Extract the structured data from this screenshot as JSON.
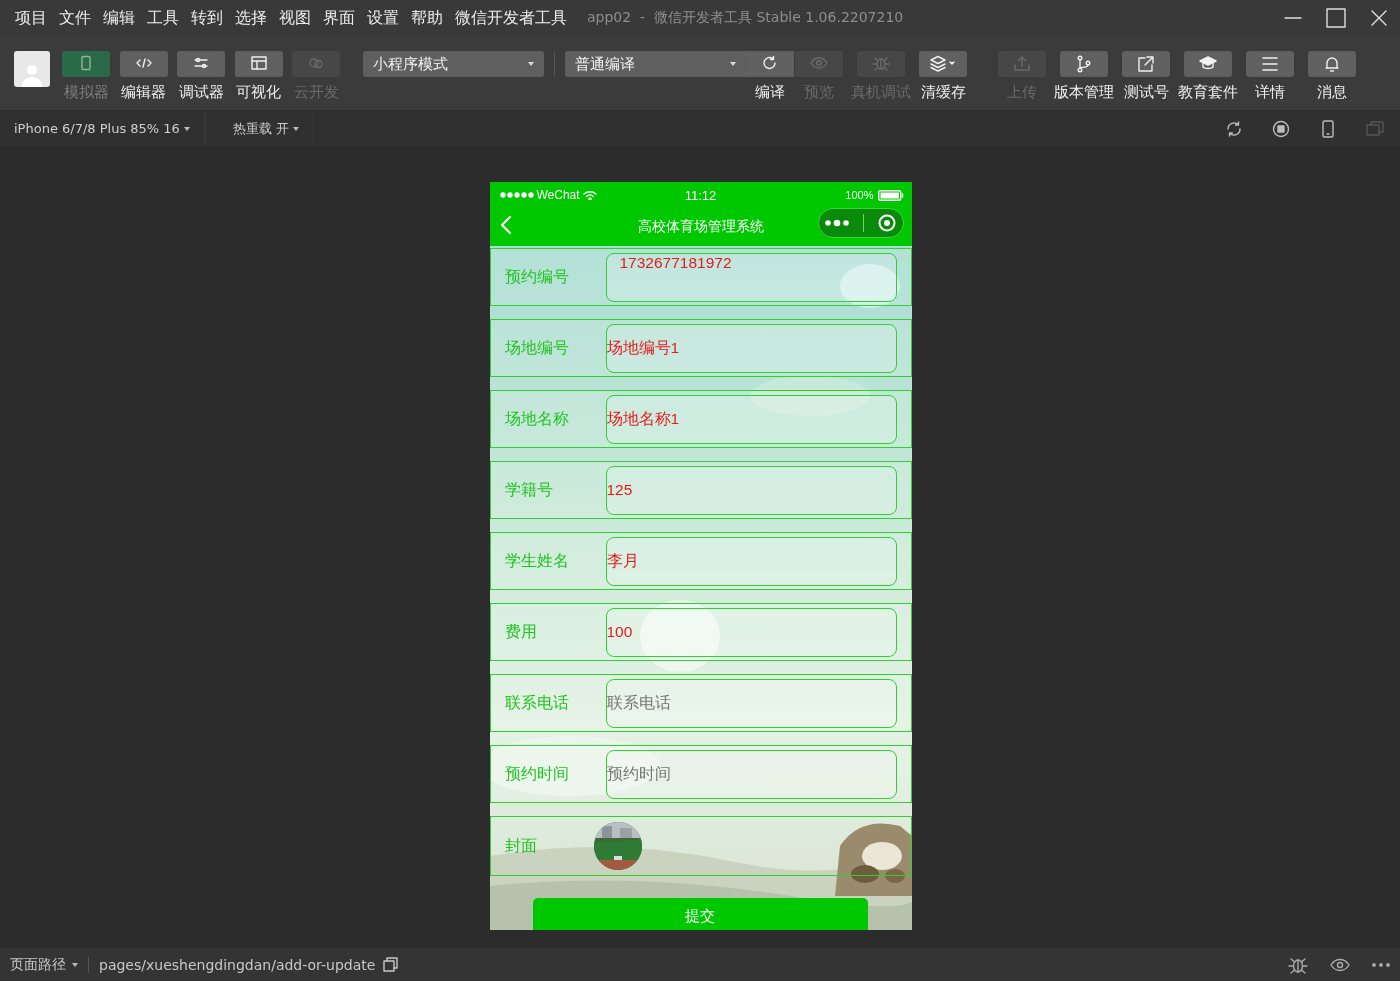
{
  "menu": [
    "项目",
    "文件",
    "编辑",
    "工具",
    "转到",
    "选择",
    "视图",
    "界面",
    "设置",
    "帮助",
    "微信开发者工具"
  ],
  "window": {
    "title": "app02  -  微信开发者工具 Stable 1.06.2207210"
  },
  "toolbar": {
    "views": [
      {
        "label": "模拟器",
        "selected": true,
        "disabled": false
      },
      {
        "label": "编辑器",
        "selected": false,
        "disabled": false
      },
      {
        "label": "调试器",
        "selected": false,
        "disabled": false
      },
      {
        "label": "可视化",
        "selected": false,
        "disabled": false
      },
      {
        "label": "云开发",
        "selected": false,
        "disabled": true
      }
    ],
    "mode_select": "小程序模式",
    "compile_select": "普通编译",
    "compile_actions": [
      {
        "label": "编译",
        "disabled": false
      },
      {
        "label": "预览",
        "disabled": true
      }
    ],
    "tools": [
      {
        "label": "真机调试",
        "disabled": true
      },
      {
        "label": "清缓存",
        "disabled": false
      }
    ],
    "project": [
      {
        "label": "上传",
        "disabled": true
      },
      {
        "label": "版本管理",
        "disabled": false
      },
      {
        "label": "测试号",
        "disabled": false
      },
      {
        "label": "教育套件",
        "disabled": false
      },
      {
        "label": "详情",
        "disabled": false
      },
      {
        "label": "消息",
        "disabled": false
      }
    ]
  },
  "subbar": {
    "device": "iPhone 6/7/8 Plus 85% 16",
    "hot_reload": "热重载 开"
  },
  "phone": {
    "status": {
      "carrier": "WeChat",
      "time": "11:12",
      "battery": "100%"
    },
    "nav_title": "高校体育场管理系统",
    "fields": [
      {
        "kind": "textarea",
        "label": "预约编号",
        "value": "1732677181972"
      },
      {
        "kind": "input",
        "label": "场地编号",
        "value": "场地编号1"
      },
      {
        "kind": "input",
        "label": "场地名称",
        "value": "场地名称1"
      },
      {
        "kind": "input",
        "label": "学籍号",
        "value": "125"
      },
      {
        "kind": "input",
        "label": "学生姓名",
        "value": "李月"
      },
      {
        "kind": "input",
        "label": "费用",
        "value": "100"
      },
      {
        "kind": "input",
        "label": "联系电话",
        "placeholder": "联系电话"
      },
      {
        "kind": "input",
        "label": "预约时间",
        "placeholder": "预约时间"
      },
      {
        "label": "封面"
      }
    ],
    "submit": "提交"
  },
  "status_bar": {
    "path_label": "页面路径",
    "path": "pages/xueshengdingdan/add-or-update"
  }
}
